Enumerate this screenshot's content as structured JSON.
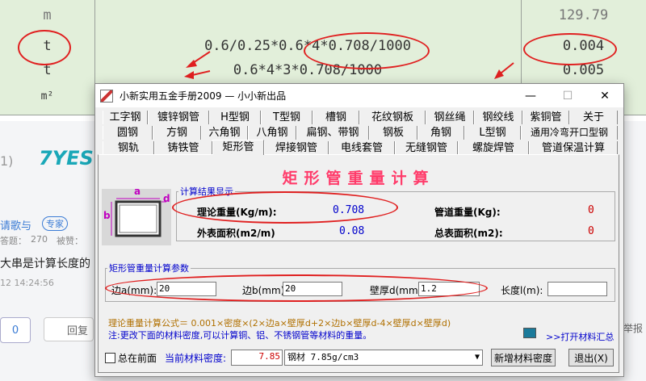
{
  "background": {
    "rows": [
      {
        "unit": "m",
        "formula": "",
        "result": "129.79"
      },
      {
        "unit": "t",
        "formula": "0.6/0.25*0.6*4*0.708/1000",
        "result": "0.004"
      },
      {
        "unit": "t",
        "formula": "0.6*4*3*0.708/1000",
        "result": "0.005"
      },
      {
        "unit": "m²",
        "formula": "",
        "result": ""
      }
    ],
    "side_texts": [
      "1)",
      "请歌与",
      "专家",
      "答题：",
      "270",
      "被赞：",
      "大串是计算长度的",
      "12 14:24:56",
      "0",
      "回复",
      "举报"
    ],
    "logo_text": "7YES"
  },
  "window": {
    "title": "小新实用五金手册2009 — 小小新出品",
    "minimize": "—",
    "maximize": "☐",
    "close": "✕"
  },
  "tabs": {
    "row1": [
      "工字钢",
      "镀锌钢管",
      "H型钢",
      "T型钢",
      "槽钢",
      "花纹钢板",
      "钢丝绳",
      "钢绞线",
      "紫铜管",
      "关于"
    ],
    "row2": [
      "圆钢",
      "方钢",
      "六角钢",
      "八角钢",
      "扁钢、带钢",
      "钢板",
      "角钢",
      "L型钢",
      "通用冷弯开口型钢"
    ],
    "row3": [
      "钢轨",
      "铸铁管",
      "矩形管",
      "焊接钢管",
      "电线套管",
      "无缝钢管",
      "螺旋焊管",
      "管道保温计算"
    ],
    "active": "矩形管"
  },
  "panel": {
    "heading": "矩形管重量计算",
    "diagram_labels": {
      "a": "a",
      "b": "b",
      "d": "d"
    },
    "results": {
      "legend": "计算结果显示",
      "theory_weight_label": "理论重量(Kg/m):",
      "theory_weight_value": "0.708",
      "pipe_weight_label": "管道重量(Kg):",
      "pipe_weight_value": "0",
      "outer_area_label": "外表面积(m2/m)",
      "outer_area_value": "0.08",
      "total_area_label": "总表面积(m2):",
      "total_area_value": "0"
    },
    "params": {
      "legend": "矩形管重量计算参数",
      "side_a_label": "边a(mm):",
      "side_a_value": "20",
      "side_b_label": "边b(mm):",
      "side_b_value": "20",
      "wall_label": "壁厚d(mm)",
      "wall_value": "1.2",
      "length_label": "长度l(m):",
      "length_value": ""
    },
    "formula": "理论重量计算公式＝ 0.001×密度×(2×边a×壁厚d+2×边b×壁厚d-4×壁厚d×壁厚d)",
    "note": "注:更改下面的材料密度,可以计算铜、铝、不锈钢管等材料的重量。",
    "open_summary": ">>打开材料汇总"
  },
  "footer": {
    "always_on_top": "总在前面",
    "density_label": "当前材料密度:",
    "density_value": "7.85",
    "material_select": "钢材 7.85g/cm3",
    "add_material": "新增材料密度",
    "exit": "退出(X)"
  },
  "colors": {
    "heading": "#ff3b6a",
    "value_blue": "#0000cc",
    "value_red": "#cc0000",
    "formula": "#b07000",
    "annotation": "#e02020"
  }
}
